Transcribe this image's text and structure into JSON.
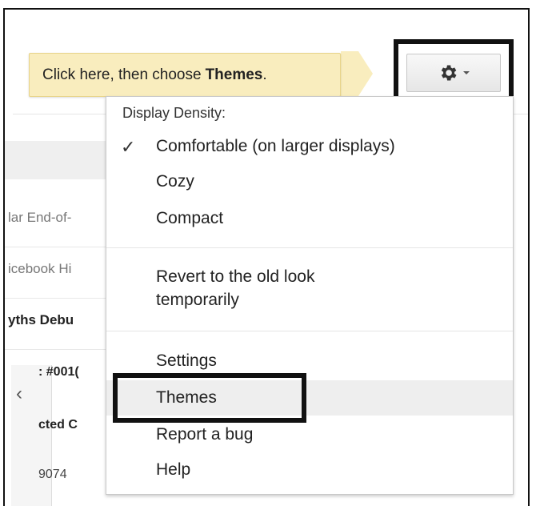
{
  "tooltip": {
    "prefix": "Click here, then choose",
    "emphasis": "Themes",
    "suffix": "."
  },
  "settings_button": {
    "icon": "gear-icon",
    "caret": "chevron-down-icon"
  },
  "menu": {
    "density_heading": "Display Density:",
    "density_options": [
      {
        "label": "Comfortable (on larger displays)",
        "checked": true
      },
      {
        "label": "Cozy",
        "checked": false
      },
      {
        "label": "Compact",
        "checked": false
      }
    ],
    "revert_label": "Revert to the old look temporarily",
    "settings_label": "Settings",
    "themes_label": "Themes",
    "report_bug_label": "Report a bug",
    "help_label": "Help"
  },
  "background_snippets": [
    "lar End-of-",
    "icebook Hi",
    "yths Debu",
    ": #001(",
    "cted C",
    "9074"
  ],
  "back_icon": "chevron-left-icon",
  "colors": {
    "tooltip_bg": "#f9edbe",
    "annotation_border": "#111111",
    "highlight": "#eeeeee"
  }
}
